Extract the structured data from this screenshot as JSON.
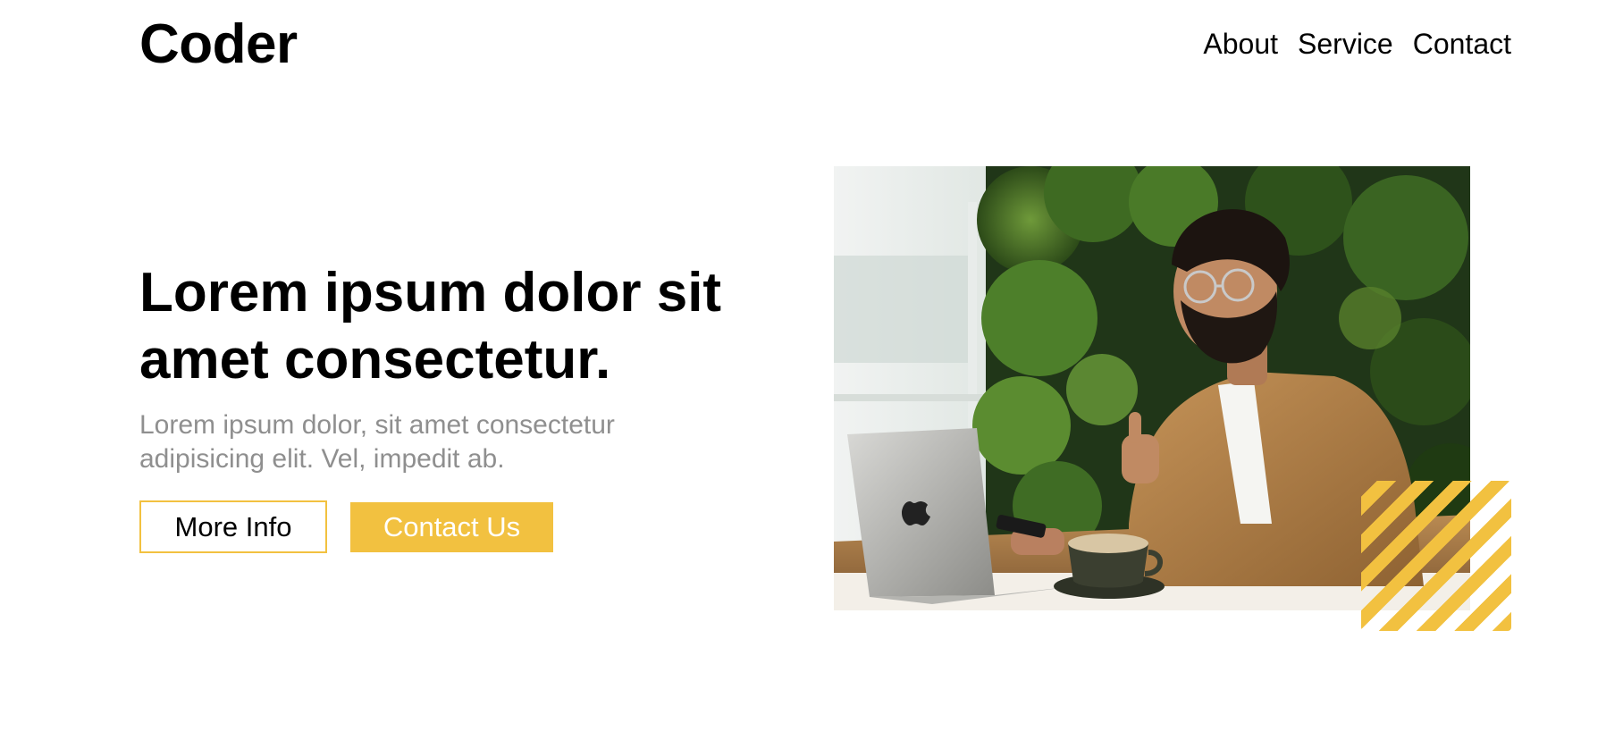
{
  "header": {
    "logo": "Coder",
    "nav": [
      {
        "label": "About"
      },
      {
        "label": "Service"
      },
      {
        "label": "Contact"
      }
    ]
  },
  "hero": {
    "title_line1": "Lorem ipsum dolor sit",
    "title_line2": "amet consectetur.",
    "subtitle_line1": "Lorem ipsum dolor, sit amet consectetur",
    "subtitle_line2": "adipisicing elit. Vel, impedit ab.",
    "buttons": {
      "more_info": "More Info",
      "contact_us": "Contact Us"
    },
    "image": {
      "subject": "man with glasses and beard at a cafe table with laptop, phone and coffee cup, giving thumbs up",
      "decoration": "yellow-diagonal-stripes"
    }
  },
  "colors": {
    "accent": "#f2c140",
    "text": "#000000",
    "muted_text": "#8f8f8f",
    "background": "#ffffff"
  }
}
